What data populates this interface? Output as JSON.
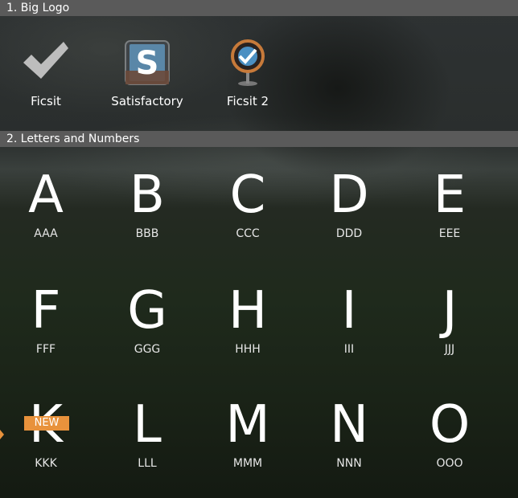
{
  "sections": [
    {
      "title": "1. Big Logo"
    },
    {
      "title": "2. Letters and Numbers"
    }
  ],
  "logos": [
    {
      "label": "Ficsit",
      "icon": "checkmark-icon"
    },
    {
      "label": "Satisfactory",
      "icon": "satisfactory-s-icon",
      "glyph": "S"
    },
    {
      "label": "Ficsit 2",
      "icon": "ficsit-globe-icon"
    }
  ],
  "letters": [
    {
      "glyph": "A",
      "label": "AAA"
    },
    {
      "glyph": "B",
      "label": "BBB"
    },
    {
      "glyph": "C",
      "label": "CCC"
    },
    {
      "glyph": "D",
      "label": "DDD"
    },
    {
      "glyph": "E",
      "label": "EEE"
    },
    {
      "glyph": "F",
      "label": "FFF"
    },
    {
      "glyph": "G",
      "label": "GGG"
    },
    {
      "glyph": "H",
      "label": "HHH"
    },
    {
      "glyph": "I",
      "label": "III"
    },
    {
      "glyph": "J",
      "label": "JJJ"
    },
    {
      "glyph": "K",
      "label": "KKK",
      "badge": "NEW"
    },
    {
      "glyph": "L",
      "label": "LLL"
    },
    {
      "glyph": "M",
      "label": "MMM"
    },
    {
      "glyph": "N",
      "label": "NNN"
    },
    {
      "glyph": "O",
      "label": "OOO"
    }
  ],
  "colors": {
    "header_bg": "#5a5a5a",
    "badge_bg": "#e8923c",
    "text": "#ffffff"
  }
}
